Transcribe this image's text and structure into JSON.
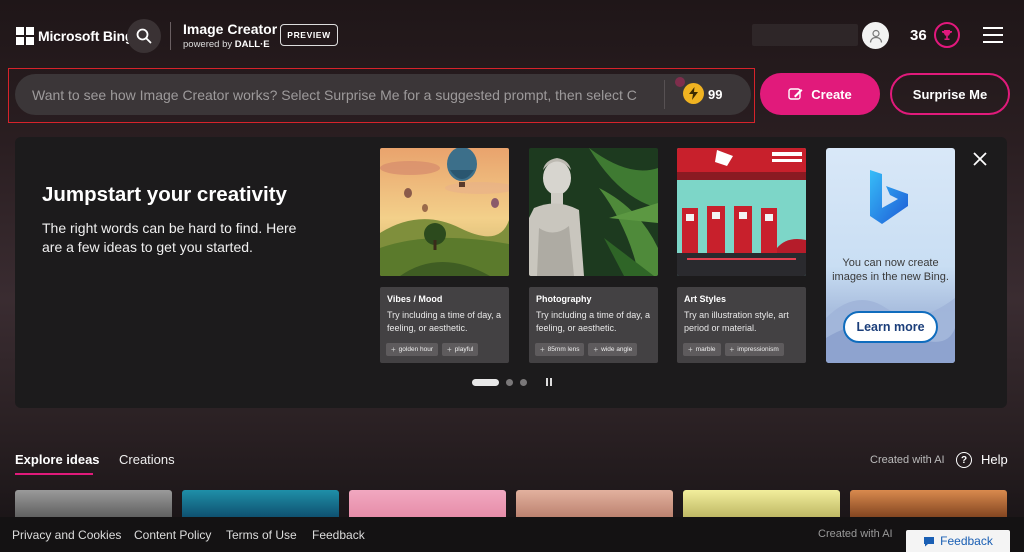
{
  "header": {
    "brand": "Microsoft Bing",
    "app_title": "Image Creator",
    "app_subtitle_prefix": "powered by",
    "app_subtitle_brand": "DALL·E",
    "preview_badge": "PREVIEW",
    "rewards_count": "36",
    "icons": [
      "microsoft-logo-icon",
      "search-icon",
      "avatar-icon",
      "rewards-trophy-icon",
      "hamburger-menu-icon"
    ]
  },
  "prompt": {
    "placeholder": "Want to see how Image Creator works? Select Surprise Me for a suggested prompt, then select C",
    "boosts": "99",
    "create_label": "Create",
    "surprise_label": "Surprise Me"
  },
  "jumpstart": {
    "title": "Jumpstart your creativity",
    "description": "The right words can be hard to find. Here are a few ideas to get you started.",
    "cards": [
      {
        "category": "Vibes / Mood",
        "tip": "Try including a time of day, a feeling, or aesthetic.",
        "tags": [
          "golden hour",
          "playful"
        ]
      },
      {
        "category": "Photography",
        "tip": "Try including a time of day, a feeling, or aesthetic.",
        "tags": [
          "85mm lens",
          "wide angle"
        ]
      },
      {
        "category": "Art Styles",
        "tip": "Try an illustration style, art period or material.",
        "tags": [
          "marble",
          "impressionism"
        ]
      }
    ],
    "promo": {
      "text": "You can now create images in the new Bing.",
      "button": "Learn more"
    },
    "pager": {
      "pages": 3,
      "active": 1
    }
  },
  "tabs": {
    "explore": "Explore ideas",
    "creations": "Creations",
    "created_with_ai": "Created with AI",
    "help": "Help"
  },
  "footer": {
    "links": [
      "Privacy and Cookies",
      "Content Policy",
      "Terms of Use",
      "Feedback"
    ],
    "created_with_ai": "Created with AI",
    "feedback_button": "Feedback"
  },
  "colors": {
    "accent": "#e11a7b",
    "highlight_outline": "#d6232b",
    "boost": "#f0b321",
    "learn_more_border": "#0f6cbd"
  }
}
